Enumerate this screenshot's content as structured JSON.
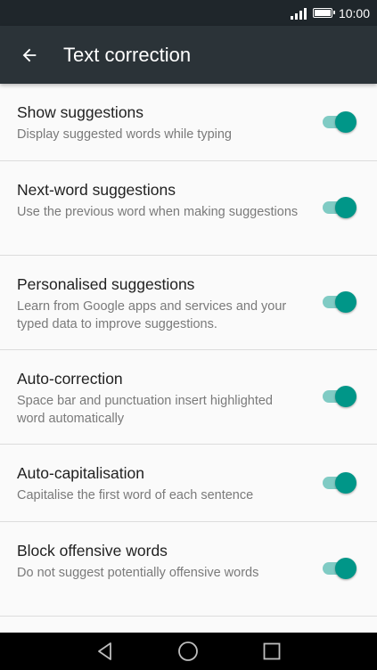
{
  "status_bar": {
    "time": "10:00",
    "signal_icon": "signal-icon",
    "battery_icon": "battery-icon"
  },
  "app_bar": {
    "back_icon": "back-arrow-icon",
    "title": "Text correction"
  },
  "settings": [
    {
      "title": "Show suggestions",
      "subtitle": "Display suggested words while typing",
      "enabled": true
    },
    {
      "title": "Next-word suggestions",
      "subtitle": "Use the previous word when making suggestions",
      "enabled": true
    },
    {
      "title": "Personalised suggestions",
      "subtitle": "Learn from Google apps and services and your typed data to improve suggestions.",
      "enabled": true
    },
    {
      "title": "Auto-correction",
      "subtitle": "Space bar and punctuation insert highlighted word automatically",
      "enabled": true
    },
    {
      "title": "Auto-capitalisation",
      "subtitle": "Capitalise the first word of each sentence",
      "enabled": true
    },
    {
      "title": "Block offensive words",
      "subtitle": "Do not suggest potentially offensive words",
      "enabled": true
    }
  ],
  "colors": {
    "accent": "#009688",
    "accent_light": "#80cbc4",
    "app_bar": "#2b3338",
    "status_bar": "#1f262b"
  },
  "nav_bar": {
    "back_icon": "nav-back-icon",
    "home_icon": "nav-home-icon",
    "recents_icon": "nav-recents-icon"
  }
}
